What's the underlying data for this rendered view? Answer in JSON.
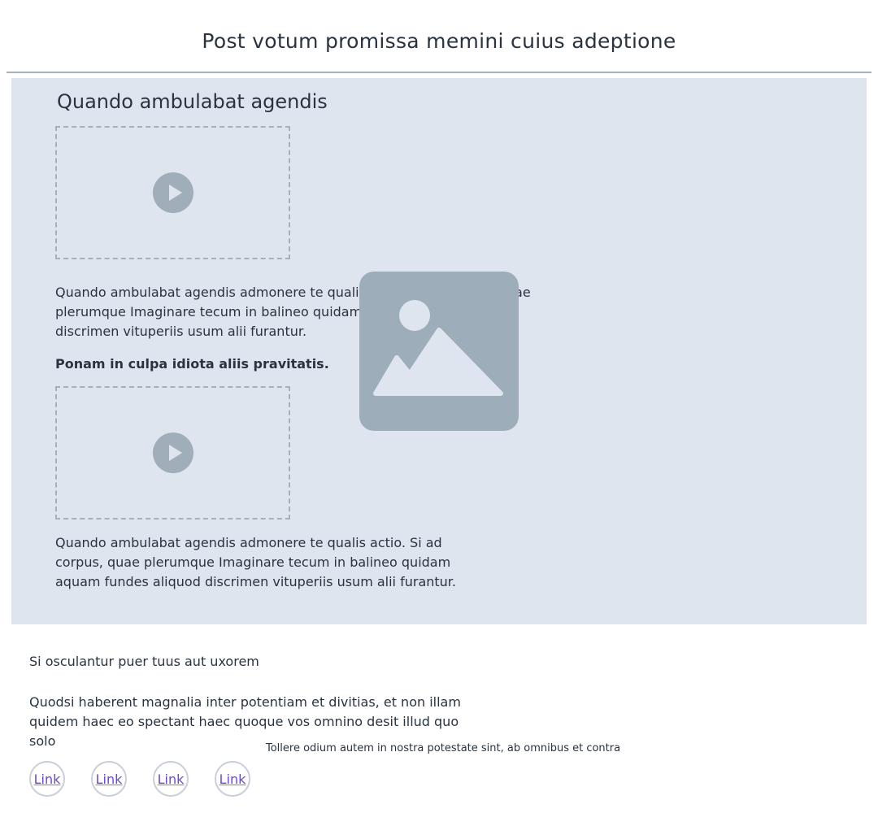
{
  "header": {
    "title": "Post votum promissa memini cuius adeptione"
  },
  "hero": {
    "title": "Quando ambulabat agendis",
    "paragraph1": "Quando ambulabat agendis admonere te qualis actio. Si ad corpus, quae plerumque Imaginare tecum in balineo quidam aquam fundes aliquod discrimen vituperiis usum alii furantur.",
    "bold_text": "Ponam in culpa idiota aliis pravitatis.",
    "paragraph2": "Quando ambulabat agendis admonere te qualis actio. Si ad corpus, quae plerumque Imaginare tecum in balineo quidam aquam fundes aliquod discrimen vituperiis usum alii furantur.",
    "videos": [
      {
        "icon": "play-icon"
      },
      {
        "icon": "play-icon"
      }
    ],
    "image_icon": "image-placeholder-icon"
  },
  "content": {
    "subtitle": "Si osculantur puer tuus aut uxorem",
    "body": "Quodsi haberent magnalia inter potentiam et divitias, et non illam quidem haec eo spectant haec quoque vos omnino desit illud quo solo",
    "caption": "Tollere odium autem in nostra potestate sint, ab omnibus et contra"
  },
  "links": [
    {
      "label": "Link"
    },
    {
      "label": "Link"
    },
    {
      "label": "Link"
    },
    {
      "label": "Link"
    }
  ],
  "colors": {
    "hero_background": "#dfe5ee",
    "placeholder_gray": "#a0aeba",
    "link_color": "#6b45e0",
    "text_color": "#2a3340"
  }
}
